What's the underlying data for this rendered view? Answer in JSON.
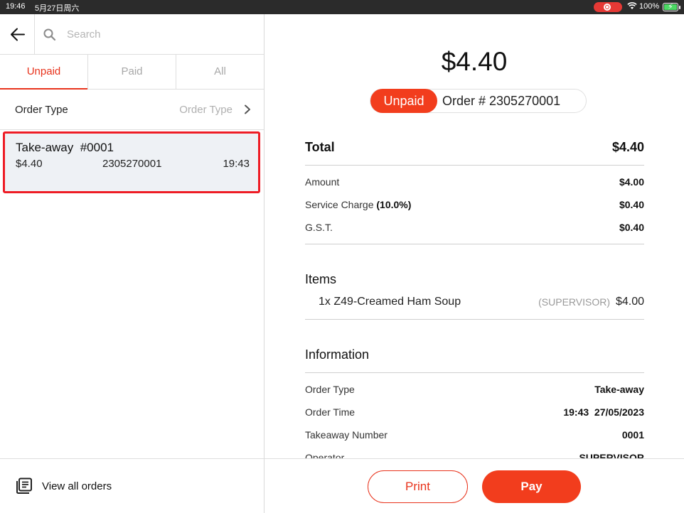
{
  "status_bar": {
    "time": "19:46",
    "date": "5月27日周六",
    "battery": "100%"
  },
  "search": {
    "placeholder": "Search"
  },
  "tabs": [
    {
      "label": "Unpaid",
      "active": true
    },
    {
      "label": "Paid",
      "active": false
    },
    {
      "label": "All",
      "active": false
    }
  ],
  "filter": {
    "label": "Order Type",
    "value": "Order Type"
  },
  "orders": [
    {
      "title": "Take-away  #0001",
      "amount": "$4.40",
      "order_number": "2305270001",
      "time": "19:43"
    }
  ],
  "left_footer": {
    "view_all": "View all orders"
  },
  "detail": {
    "total_display": "$4.40",
    "status": "Unpaid",
    "order_label": "Order # 2305270001",
    "total_label": "Total",
    "total_value": "$4.40",
    "amount_label": "Amount",
    "amount_value": "$4.00",
    "service_label": "Service Charge ",
    "service_rate": "(10.0%)",
    "service_value": "$0.40",
    "gst_label": "G.S.T.",
    "gst_value": "$0.40",
    "items_heading": "Items",
    "items": [
      {
        "name": "1x Z49-Creamed Ham Soup",
        "by": "(SUPERVISOR)",
        "price": "$4.00"
      }
    ],
    "info_heading": "Information",
    "info": [
      {
        "label": "Order Type",
        "value": "Take-away"
      },
      {
        "label": "Order Time",
        "value": "19:43  27/05/2023"
      },
      {
        "label": "Takeaway Number",
        "value": "0001"
      },
      {
        "label": "Operator",
        "value": "SUPERVISOR"
      }
    ]
  },
  "actions": {
    "print": "Print",
    "pay": "Pay"
  },
  "colors": {
    "accent": "#f23d1d",
    "selection_border": "#ee1c25",
    "card_bg": "#eef1f5"
  }
}
